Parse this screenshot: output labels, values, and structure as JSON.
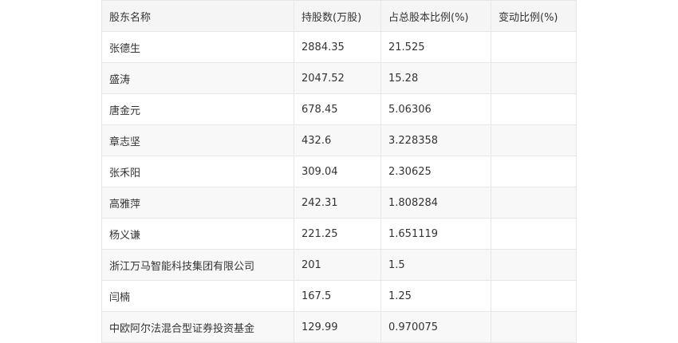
{
  "table": {
    "headers": [
      "股东名称",
      "持股数(万股)",
      "占总股本比例(%)",
      "变动比例(%)"
    ],
    "rows": [
      [
        "张德生",
        "2884.35",
        "21.525",
        ""
      ],
      [
        "盛涛",
        "2047.52",
        "15.28",
        ""
      ],
      [
        "唐金元",
        "678.45",
        "5.06306",
        ""
      ],
      [
        "章志坚",
        "432.6",
        "3.228358",
        ""
      ],
      [
        "张禾阳",
        "309.04",
        "2.30625",
        ""
      ],
      [
        "高雅萍",
        "242.31",
        "1.808284",
        ""
      ],
      [
        "杨义谦",
        "221.25",
        "1.651119",
        ""
      ],
      [
        "浙江万马智能科技集团有限公司",
        "201",
        "1.5",
        ""
      ],
      [
        "闫楠",
        "167.5",
        "1.25",
        ""
      ],
      [
        "中欧阿尔法混合型证券投资基金",
        "129.99",
        "0.970075",
        ""
      ]
    ]
  }
}
